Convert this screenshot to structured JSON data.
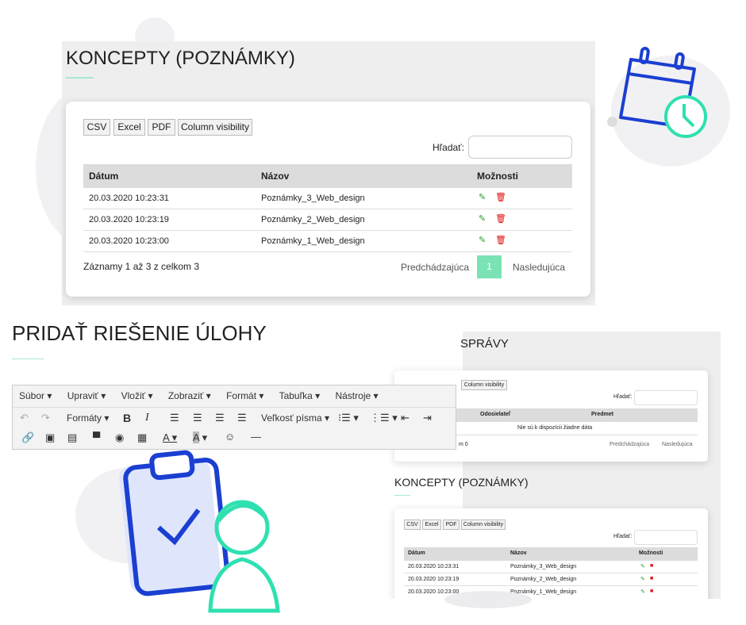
{
  "top": {
    "title": "KONCEPTY (POZNÁMKY)",
    "buttons": [
      "CSV",
      "Excel",
      "PDF",
      "Column visibility"
    ],
    "search_label": "Hľadať:",
    "search_value": "",
    "columns": [
      "Dátum",
      "Názov",
      "Možnosti"
    ],
    "rows": [
      {
        "date": "20.03.2020 10:23:31",
        "name": "Poznámky_3_Web_design"
      },
      {
        "date": "20.03.2020 10:23:19",
        "name": "Poznámky_2_Web_design"
      },
      {
        "date": "20.03.2020 10:23:00",
        "name": "Poznámky_1_Web_design"
      }
    ],
    "info": "Záznamy 1 až 3 z celkom 3",
    "prev": "Predchádzajúca",
    "page": "1",
    "next": "Nasledujúca"
  },
  "editor": {
    "title": "PRIDAŤ RIEŠENIE ÚLOHY",
    "menu": [
      "Súbor ▾",
      "Upraviť ▾",
      "Vložiť ▾",
      "Zobraziť ▾",
      "Formát ▾",
      "Tabuľka ▾",
      "Nástroje ▾"
    ],
    "formats": "Formáty ▾",
    "font_size": "Veľkosť písma ▾"
  },
  "messages": {
    "title": "SPRÁVY",
    "button": "Column visibility",
    "search_label": "Hľadať:",
    "columns": [
      "Odosielateľ",
      "Predmet"
    ],
    "empty": "Nie sú k dispozícii žiadne dáta",
    "info": "m 0",
    "prev": "Predchádzajúca",
    "next": "Nasledujúca"
  },
  "small": {
    "title": "KONCEPTY (POZNÁMKY)",
    "buttons": [
      "CSV",
      "Excel",
      "PDF",
      "Column visibility"
    ],
    "search_label": "Hľadať:",
    "columns": [
      "Dátum",
      "Názov",
      "Možnosti"
    ],
    "rows": [
      {
        "date": "20.03.2020 10:23:31",
        "name": "Poznámky_3_Web_design"
      },
      {
        "date": "20.03.2020 10:23:19",
        "name": "Poznámky_2_Web_design"
      },
      {
        "date": "20.03.2020 10:23:00",
        "name": "Poznámky_1_Web_design"
      }
    ]
  },
  "colors": {
    "accent": "#7be3b3",
    "blue": "#1a3fd1",
    "teal": "#2fe0b0",
    "edit": "#2a9d2a",
    "delete": "#e01010"
  }
}
